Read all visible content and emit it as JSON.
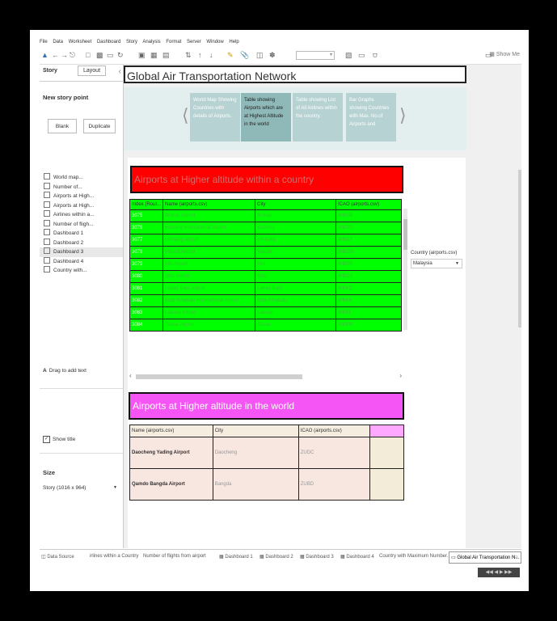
{
  "menu": [
    "File",
    "Data",
    "Worksheet",
    "Dashboard",
    "Story",
    "Analysis",
    "Format",
    "Server",
    "Window",
    "Help"
  ],
  "toolbar": {
    "show_me_label": "Show Me"
  },
  "left_panel": {
    "tabs": {
      "story": "Story",
      "layout": "Layout"
    },
    "new_story_point": "New story point",
    "blank_button": "Blank",
    "duplicate_button": "Duplicate",
    "sheets": [
      {
        "label": "World map..."
      },
      {
        "label": "Number of..."
      },
      {
        "label": "Airports at High..."
      },
      {
        "label": "Airports at High..."
      },
      {
        "label": "Airlines within a..."
      },
      {
        "label": "Number of fligh..."
      },
      {
        "label": "Dashboard 1"
      },
      {
        "label": "Dashboard 2"
      },
      {
        "label": "Dashboard 3"
      },
      {
        "label": "Dashboard 4"
      },
      {
        "label": "Country with..."
      }
    ],
    "drag_to_add_text": "Drag to add text",
    "show_title": "Show title",
    "size_title": "Size",
    "size_value": "Story (1016 x 964)"
  },
  "story": {
    "title": "Global Air Transportation Network",
    "points": [
      "World Map Showing Countries with details of Airports.",
      "Table showing Airports which are at Highest Altitude in the world",
      "Table showing List of All Airlines within the country.",
      "Bar Graphs showing Countries with Max. No.of Airports and"
    ]
  },
  "dashboard": {
    "banner1": "Airports at Higher altitude within a country",
    "table1": {
      "headers": [
        "Index (Rout...",
        "Name (airports.csv)",
        "City",
        "ICAO (airports.csv)"
      ],
      "rows": [
        [
          "3075",
          "Bintulu Airport",
          "Bintulu",
          "WBGB"
        ],
        [
          "3076",
          "Kuching International Airport",
          "Kuching",
          "WBGG"
        ],
        [
          "3077",
          "Limbang Airport",
          "Limbang",
          "WBGJ"
        ],
        [
          "3078",
          "Marudi Airport",
          "Marudi",
          "WBGM"
        ],
        [
          "3079",
          "Miri Airport",
          "Miri",
          "WBGR"
        ],
        [
          "3080",
          "Sibu Airport",
          "Sibu",
          "WBGS"
        ],
        [
          "3081",
          "Lahad Datu Airport",
          "Lahad Datu",
          "WBKD"
        ],
        [
          "3082",
          "Kota Kinabalu International Airport",
          "Kota Kinabalu",
          "WBKK"
        ],
        [
          "3083",
          "Labuan Airport",
          "Labuan",
          "WBKL"
        ],
        [
          "3084",
          "Tawau Airport",
          "Tawau",
          "WBKW"
        ]
      ]
    },
    "banner2": "Airports at Higher altitude in the world",
    "table2": {
      "headers": [
        "Name (airports.csv)",
        "City",
        "ICAO (airports.csv)"
      ],
      "rows": [
        [
          "Daocheng Yading Airport",
          "Daocheng",
          "ZUDC"
        ],
        [
          "Qamdo Bangda Airport",
          "Bangda",
          "ZUBD"
        ]
      ]
    },
    "filter": {
      "title": "Country (airports.csv)",
      "value": "Malaysia"
    }
  },
  "bottom_tabs": [
    "Data Source",
    "irlines within a Country",
    "Number of flights from airport",
    "Dashboard 1",
    "Dashboard 2",
    "Dashboard 3",
    "Dashboard 4",
    "Country with Maximum Number...",
    "Global Air Transportation N..."
  ]
}
